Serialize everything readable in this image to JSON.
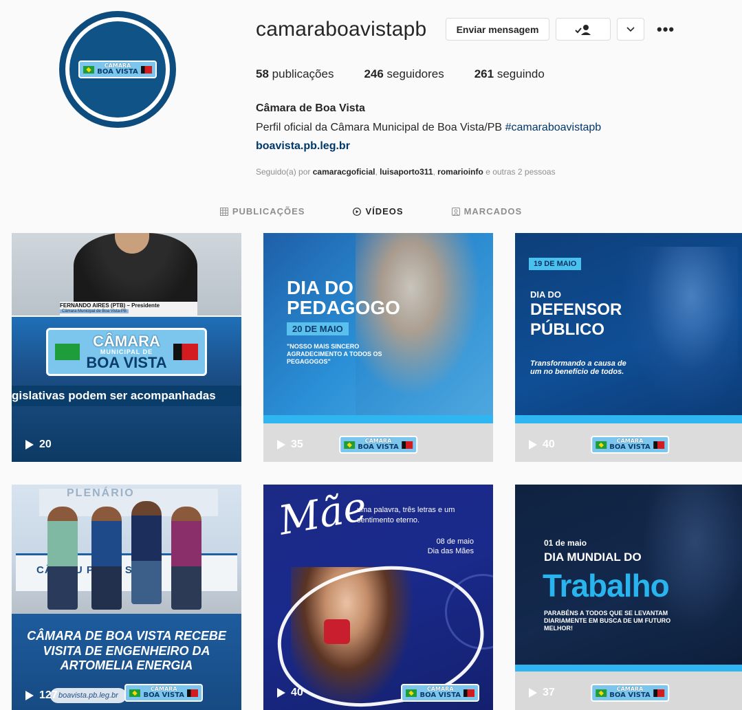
{
  "profile": {
    "username": "camaraboavistapb",
    "message_button": "Enviar mensagem",
    "follow_icon": "check-person-icon",
    "dropdown_icon": "chevron-down-icon",
    "more_icon": "ellipsis-icon",
    "more_label": "•••",
    "stats": {
      "posts_count": "58",
      "posts_label": "publicações",
      "followers_count": "246",
      "followers_label": "seguidores",
      "following_count": "261",
      "following_label": "seguindo"
    },
    "full_name": "Câmara de Boa Vista",
    "bio": "Perfil oficial da Câmara Municipal de Boa Vista/PB",
    "bio_hashtag": "#camaraboavistapb",
    "website": "boavista.pb.leg.br",
    "followed_by_prefix": "Seguido(a) por",
    "followed_by_users": [
      "camaracgoficial",
      "luisaporto311",
      "romarioinfo"
    ],
    "followed_by_suffix": "e outras 2 pessoas"
  },
  "logo": {
    "line1": "CÂMARA",
    "line2": "BOA VISTA",
    "municipal": "MUNICIPAL DE"
  },
  "tabs": [
    {
      "label": "PUBLICAÇÕES",
      "icon": "grid-icon",
      "active": false
    },
    {
      "label": "VÍDEOS",
      "icon": "play-circle-icon",
      "active": true
    },
    {
      "label": "MARCADOS",
      "icon": "tagged-icon",
      "active": false
    }
  ],
  "videos": [
    {
      "views": "20",
      "caption_name": "FERNANDO AIRES (PTB) – Presidente",
      "caption_sub": "Câmara Municipal de Boa Vista-PB",
      "ticker": "gislativas podem ser acompanhadas"
    },
    {
      "views": "35",
      "title_line1": "DIA DO",
      "title_line2": "PEDAGOGO",
      "date": "20 DE MAIO",
      "quote": "\"NOSSO MAIS SINCERO AGRADECIMENTO A TODOS OS PEGAGOGOS\""
    },
    {
      "views": "40",
      "date": "19 DE MAIO",
      "line1": "DIA DO",
      "line2": "DEFENSOR",
      "line3": "PÚBLICO",
      "subtitle": "Transformando a causa de um no benefício de todos."
    },
    {
      "views": "127",
      "board": "PLENÁRIO",
      "desk": "CÂM   MU   PA   BO   STA",
      "headline": "CÂMARA DE BOA VISTA RECEBE VISITA DE ENGENHEIRO DA ARTOMELIA ENERGIA",
      "url": "boavista.pb.leg.br"
    },
    {
      "views": "40",
      "mae": "Mãe",
      "subtitle": "uma palavra, três letras e um sentimento eterno.",
      "date_line1": "08 de maio",
      "date_line2": "Dia das Mães"
    },
    {
      "views": "37",
      "date": "01 de maio",
      "line1": "DIA MUNDIAL DO",
      "big": "Trabalho",
      "message": "PARABÉNS A TODOS QUE SE LEVANTAM DIARIAMENTE EM BUSCA DE UM FUTURO MELHOR!"
    }
  ]
}
